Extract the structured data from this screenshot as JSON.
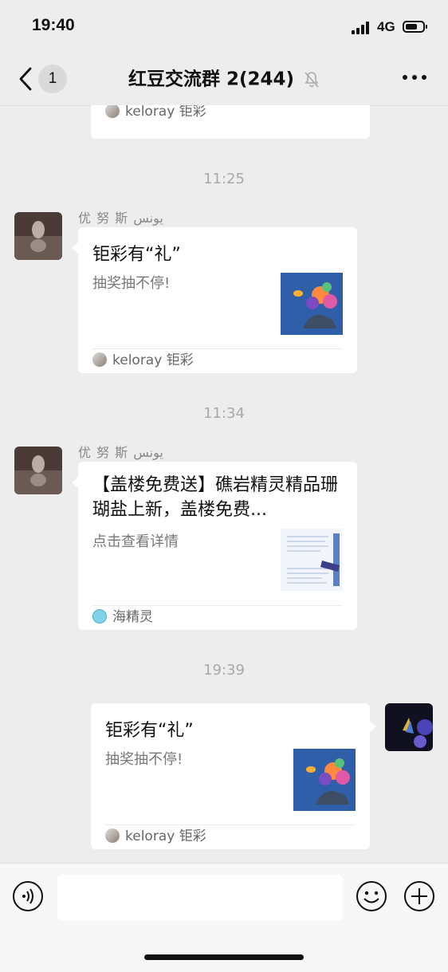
{
  "status": {
    "time": "19:40",
    "network": "4G",
    "battery_level": 0.7
  },
  "nav": {
    "back_count": "1",
    "title": "红豆交流群 2(244)"
  },
  "messages": [
    {
      "type": "time",
      "text": "11:25"
    },
    {
      "type": "card",
      "sender": "优 努 斯  يونس",
      "title": "钜彩有“礼”",
      "desc": "抽奖抽不停!",
      "source": "keloray 钜彩",
      "thumb_icon": "coral-reef-image"
    },
    {
      "type": "time",
      "text": "11:34"
    },
    {
      "type": "card",
      "sender": "优 努 斯  يونس",
      "title": "【盖楼免费送】礁岩精灵精品珊瑚盐上新，盖楼免费...",
      "desc": "点击查看详情",
      "source": "海精灵",
      "thumb_icon": "salt-product-image"
    },
    {
      "type": "time",
      "text": "19:39"
    },
    {
      "type": "card",
      "sender": "",
      "title": "钜彩有“礼”",
      "desc": "抽奖抽不停!",
      "source": "keloray 钜彩",
      "thumb_icon": "coral-reef-image"
    }
  ],
  "partial_card": {
    "source": "keloray 钜彩"
  },
  "colors": {
    "background": "#ededed",
    "card": "#ffffff",
    "muted_text": "#888888",
    "thumb_bg": "#2f5fa8"
  }
}
